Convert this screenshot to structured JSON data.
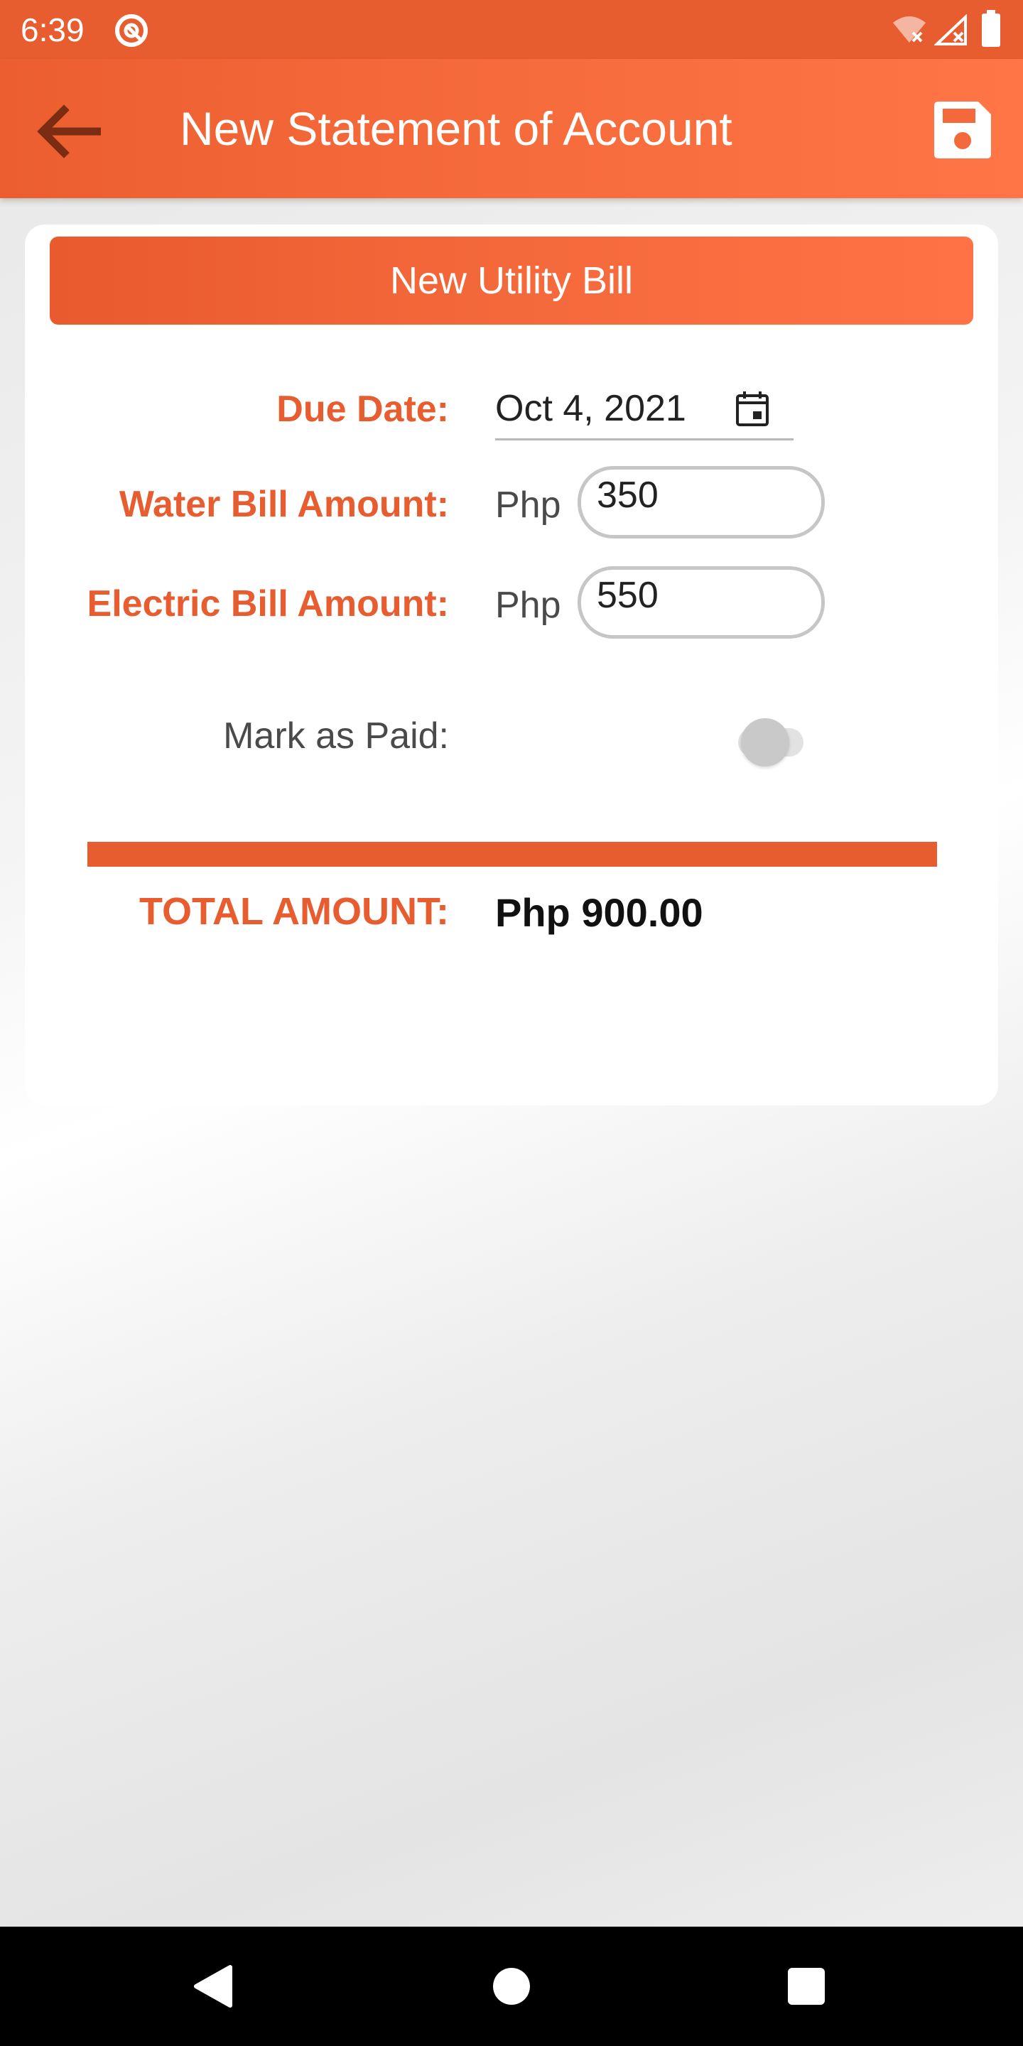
{
  "status_bar": {
    "time": "6:39",
    "icons": [
      "app-notification-icon",
      "wifi-off-icon",
      "signal-off-icon",
      "battery-icon"
    ]
  },
  "app_bar": {
    "title": "New Statement of Account",
    "back_icon": "arrow-left-icon",
    "save_icon": "floppy-disk-icon"
  },
  "form": {
    "header": "New Utility Bill",
    "due_date": {
      "label": "Due Date:",
      "value": "Oct 4, 2021",
      "icon": "calendar-icon"
    },
    "water_bill": {
      "label": "Water Bill Amount:",
      "currency": "Php",
      "value": "350"
    },
    "electric_bill": {
      "label": "Electric Bill Amount:",
      "currency": "Php",
      "value": "550"
    },
    "mark_paid": {
      "label": "Mark as Paid:",
      "checked": false
    },
    "total": {
      "label": "TOTAL AMOUNT:",
      "value": "Php 900.00"
    }
  },
  "nav_bar": {
    "buttons": [
      "back-triangle-icon",
      "home-circle-icon",
      "recents-square-icon"
    ]
  },
  "colors": {
    "accent": "#e85d2f",
    "label_text": "#e85d2f",
    "toggle_off": "#c9c9c9"
  }
}
